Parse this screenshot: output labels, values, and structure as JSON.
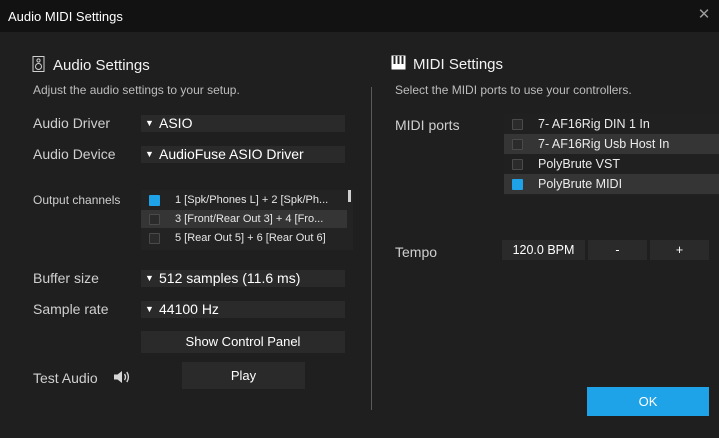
{
  "window": {
    "title": "Audio MIDI Settings",
    "close_glyph": "✕"
  },
  "audio": {
    "title": "Audio Settings",
    "subtitle": "Adjust the audio settings to your setup.",
    "driver_label": "Audio Driver",
    "driver_value": "ASIO",
    "device_label": "Audio Device",
    "device_value": "AudioFuse ASIO Driver",
    "output_label": "Output channels",
    "outputs": [
      {
        "label": "1 [Spk/Phones L] + 2 [Spk/Ph...",
        "checked": true
      },
      {
        "label": "3 [Front/Rear Out 3] + 4 [Fro...",
        "checked": false
      },
      {
        "label": "5 [Rear Out 5] + 6 [Rear Out 6]",
        "checked": false
      }
    ],
    "buffer_label": "Buffer size",
    "buffer_value": "512 samples (11.6 ms)",
    "rate_label": "Sample rate",
    "rate_value": "44100 Hz",
    "control_panel_button": "Show Control Panel",
    "test_label": "Test Audio",
    "play_button": "Play"
  },
  "midi": {
    "title": "MIDI Settings",
    "subtitle": "Select the MIDI ports to use your controllers.",
    "ports_label": "MIDI ports",
    "ports": [
      {
        "label": "7- AF16Rig DIN 1 In",
        "checked": false
      },
      {
        "label": "7- AF16Rig Usb Host In",
        "checked": false
      },
      {
        "label": "PolyBrute VST",
        "checked": false
      },
      {
        "label": "PolyBrute MIDI",
        "checked": true
      }
    ],
    "tempo_label": "Tempo",
    "tempo_value": "120.0 BPM",
    "tempo_minus": "-",
    "tempo_plus": "+"
  },
  "ok_button": "OK",
  "icons": {
    "audio": "speaker-icon",
    "midi": "piano-keys-icon",
    "test": "speaker-volume-icon",
    "dropdown": "triangle-down-icon"
  },
  "colors": {
    "accent": "#1fa3e8",
    "background": "#1f1f1f",
    "titlebar": "#121212"
  }
}
